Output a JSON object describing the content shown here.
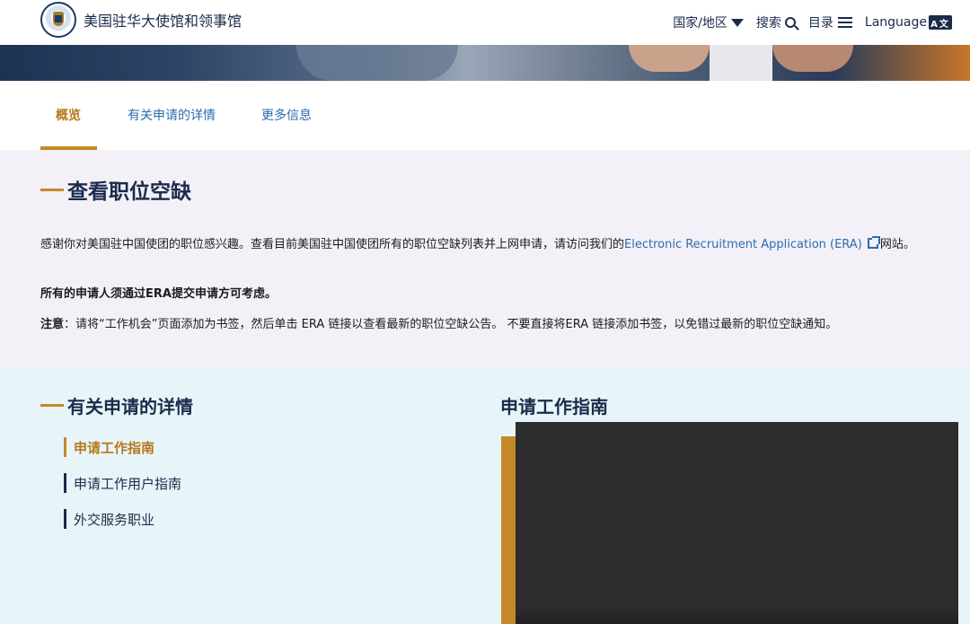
{
  "header": {
    "site_title": "美国驻华大使馆和领事馆",
    "nav": {
      "country": "国家/地区",
      "search": "搜索",
      "menu": "目录",
      "language": "Language",
      "language_icon_text": "A文"
    }
  },
  "tabs": [
    {
      "label": "概览",
      "active": true
    },
    {
      "label": "有关申请的详情",
      "active": false
    },
    {
      "label": "更多信息",
      "active": false
    }
  ],
  "overview": {
    "heading": "查看职位空缺",
    "para1_before": "感谢你对美国驻中国使团的职位感兴趣。查看目前美国驻中国使团所有的职位空缺列表并上网申请，请访问我们的",
    "para1_link": "Electronic Recruitment Application (ERA)",
    "para1_after": "网站。",
    "para2": "所有的申请人须通过ERA提交申请方可考虑。",
    "para3_label": "注意",
    "para3_text": "：请将“工作机会”页面添加为书签，然后单击 ERA 链接以查看最新的职位空缺公告。 不要直接将ERA 链接添加书签，以免错过最新的职位空缺通知。"
  },
  "details": {
    "heading": "有关申请的详情",
    "links": [
      {
        "label": "申请工作指南",
        "active": true
      },
      {
        "label": "申请工作用户指南",
        "active": false
      },
      {
        "label": "外交服务职业",
        "active": false
      }
    ],
    "guide_title": "申请工作指南"
  },
  "colors": {
    "navy": "#1a2b4c",
    "gold": "#c5882a",
    "link_blue": "#2b6cb0",
    "overview_bg": "#f3f0f8",
    "details_bg": "#e8f5f8"
  },
  "icons": [
    "seal-logo",
    "chevron-down-icon",
    "search-icon",
    "menu-icon",
    "language-icon",
    "external-link-icon"
  ]
}
